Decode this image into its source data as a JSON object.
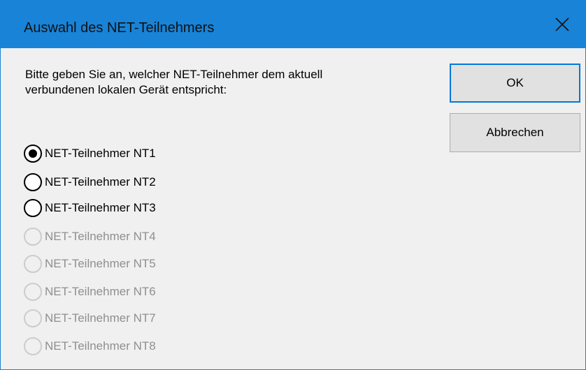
{
  "dialog": {
    "title": "Auswahl des NET-Teilnehmers",
    "prompt_line1": "Bitte geben Sie an, welcher NET-Teilnehmer dem aktuell",
    "prompt_line2": "verbundenen lokalen Gerät entspricht:",
    "ok_label": "OK",
    "cancel_label": "Abbrechen",
    "options": [
      {
        "label": "NET-Teilnehmer NT1",
        "checked": true,
        "enabled": true
      },
      {
        "label": "NET-Teilnehmer NT2",
        "checked": false,
        "enabled": true
      },
      {
        "label": "NET-Teilnehmer NT3",
        "checked": false,
        "enabled": true
      },
      {
        "label": "NET-Teilnehmer NT4",
        "checked": false,
        "enabled": false
      },
      {
        "label": "NET-Teilnehmer NT5",
        "checked": false,
        "enabled": false
      },
      {
        "label": "NET-Teilnehmer NT6",
        "checked": false,
        "enabled": false
      },
      {
        "label": "NET-Teilnehmer NT7",
        "checked": false,
        "enabled": false
      },
      {
        "label": "NET-Teilnehmer NT8",
        "checked": false,
        "enabled": false
      }
    ]
  },
  "colors": {
    "titlebar": "#1883d7",
    "dialog_background": "#f0f0f0",
    "disabled_text": "#8f8f8f",
    "default_button_border": "#0078d7"
  },
  "icons": {
    "close": "close-icon"
  }
}
